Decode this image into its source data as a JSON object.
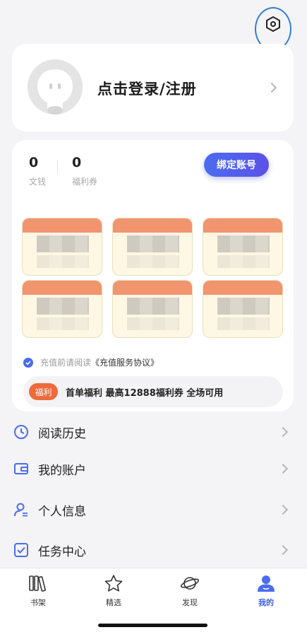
{
  "header": {
    "settings_icon": "hexagon-settings-icon"
  },
  "login": {
    "label": "点击登录/注册",
    "avatar_icon": "default-avatar-icon"
  },
  "wallet": {
    "coins_value": "0",
    "coins_label": "文钱",
    "coupons_value": "0",
    "coupons_label": "福利券",
    "bind_button": "绑定账号"
  },
  "agreement": {
    "prefix": "充值前请阅读",
    "link": "《充值服务协议》"
  },
  "promo": {
    "badge": "福利",
    "text": "首单福利 最高12888福利券 全场可用"
  },
  "menu": {
    "items": [
      {
        "label": "阅读历史",
        "icon": "clock-icon"
      },
      {
        "label": "我的账户",
        "icon": "wallet-icon"
      },
      {
        "label": "个人信息",
        "icon": "user-icon"
      },
      {
        "label": "任务中心",
        "icon": "task-check-icon"
      }
    ]
  },
  "tabs": [
    {
      "label": "书架",
      "icon": "bookshelf-icon"
    },
    {
      "label": "精选",
      "icon": "star-icon"
    },
    {
      "label": "发现",
      "icon": "planet-icon"
    },
    {
      "label": "我的",
      "icon": "profile-icon",
      "active": true
    }
  ],
  "colors": {
    "accent": "#4a6cf0",
    "promo": "#ee6a3b",
    "annotation": "#2f7fd6"
  }
}
